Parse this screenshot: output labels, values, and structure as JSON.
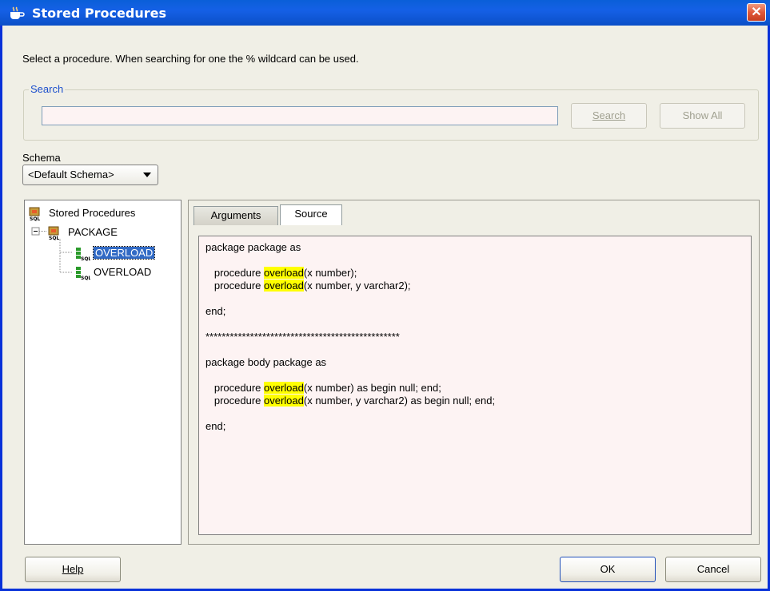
{
  "window": {
    "title": "Stored Procedures",
    "close_glyph": "✕"
  },
  "instructions": "Select a procedure. When searching for one the % wildcard can be used.",
  "search": {
    "legend": "Search",
    "value": "",
    "search_button": "Search",
    "show_all_button": "Show All"
  },
  "schema": {
    "label": "Schema",
    "selected": "<Default Schema>"
  },
  "tree": {
    "root": "Stored Procedures",
    "package": "PACKAGE",
    "items": [
      {
        "label": "OVERLOAD",
        "selected": true
      },
      {
        "label": "OVERLOAD",
        "selected": false
      }
    ]
  },
  "tabs": [
    {
      "label": "Arguments",
      "active": false
    },
    {
      "label": "Source",
      "active": true
    }
  ],
  "source": {
    "highlight": "overload",
    "lines": [
      "package package as",
      "",
      "   procedure overload(x number);",
      "   procedure overload(x number, y varchar2);",
      "",
      "end;",
      "",
      "************************************************",
      "",
      "package body package as",
      "",
      "   procedure overload(x number) as begin null; end;",
      "   procedure overload(x number, y varchar2) as begin null; end;",
      "",
      "end;"
    ]
  },
  "footer": {
    "help_button": "Help",
    "ok_button": "OK",
    "cancel_button": "Cancel"
  },
  "colors": {
    "titlebar": "#0b4fc7",
    "selection": "#316ac5",
    "highlight": "#ffff00",
    "close": "#e0583a"
  }
}
